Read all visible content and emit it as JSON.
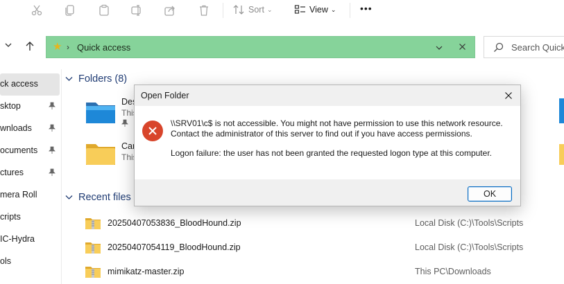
{
  "toolbar": {
    "sort_label": "Sort",
    "view_label": "View",
    "more_label": "•••"
  },
  "address": {
    "path_label": "Quick access",
    "search_placeholder": "Search Quick a"
  },
  "sidebar": {
    "items": [
      {
        "label": "ck access",
        "selected": true,
        "pinned": false
      },
      {
        "label": "sktop",
        "pinned": true
      },
      {
        "label": "wnloads",
        "pinned": true
      },
      {
        "label": "ocuments",
        "pinned": true
      },
      {
        "label": "ctures",
        "pinned": true
      },
      {
        "label": "mera Roll",
        "pinned": false
      },
      {
        "label": "cripts",
        "pinned": false
      },
      {
        "label": "IC-Hydra",
        "pinned": false
      },
      {
        "label": "ols",
        "pinned": false
      }
    ]
  },
  "main": {
    "folders_header": "Folders (8)",
    "folders": [
      {
        "name": "Des",
        "sub": "This"
      },
      {
        "name": "Car",
        "sub": "This"
      }
    ],
    "recent_header": "Recent files (",
    "recent_files": [
      {
        "name": "20250407053836_BloodHound.zip",
        "location": "Local Disk (C:)\\Tools\\Scripts"
      },
      {
        "name": "20250407054119_BloodHound.zip",
        "location": "Local Disk (C:)\\Tools\\Scripts"
      },
      {
        "name": "mimikatz-master.zip",
        "location": "This PC\\Downloads"
      }
    ]
  },
  "dialog": {
    "title": "Open Folder",
    "message_line1": "\\\\SRV01\\c$ is not accessible. You might not have permission to use this network resource.",
    "message_line2": "Contact the administrator of this server to find out if you have access permissions.",
    "message_line3": "Logon failure: the user has not been granted the requested logon type at this computer.",
    "ok_label": "OK"
  },
  "colors": {
    "address_bar": "#86d39a",
    "error_icon": "#d8452b",
    "accent": "#0067c0",
    "section_header": "#1f3b73"
  }
}
